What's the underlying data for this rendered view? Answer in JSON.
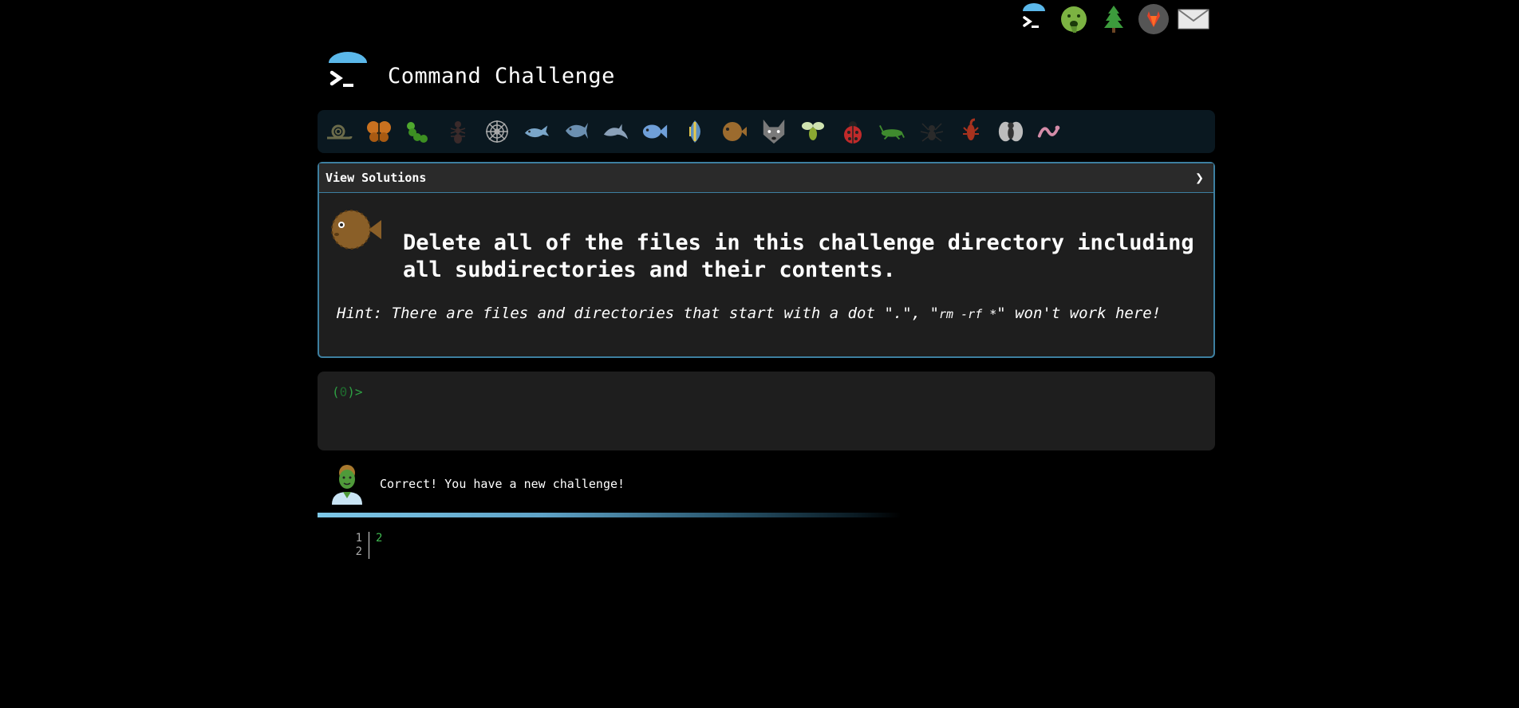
{
  "topnav": {
    "items": [
      {
        "name": "terminal-logo-icon"
      },
      {
        "name": "tux-face-icon"
      },
      {
        "name": "tree-icon"
      },
      {
        "name": "gitlab-icon"
      },
      {
        "name": "mail-icon"
      }
    ]
  },
  "header": {
    "title": "Command Challenge"
  },
  "levels": [
    "snail",
    "butterfly",
    "caterpillar",
    "ant",
    "spider-web",
    "whale",
    "shark",
    "dolphin",
    "fish",
    "tropical-fish",
    "blowfish",
    "wolf",
    "bee",
    "ladybug",
    "cricket",
    "spider",
    "scorpion",
    "fly",
    "worm"
  ],
  "challenge": {
    "solutions_label": "View Solutions",
    "chevron": "❯",
    "text": "Delete all of the files in this challenge directory including all subdirectories and their contents.",
    "hint_prefix": "Hint: There are files and directories that start with a dot \".\", \"",
    "hint_code": "rm -rf *",
    "hint_suffix": "\" won't work here!"
  },
  "terminal": {
    "prompt_open": "(",
    "prompt_zero": "0",
    "prompt_close": ")>",
    "input_value": ""
  },
  "feedback": {
    "message": "Correct! You have a new challenge!"
  },
  "output": {
    "line_numbers": [
      "1",
      "2"
    ],
    "lines": [
      "2",
      ""
    ]
  },
  "colors": {
    "accent": "#3d7fa0",
    "prompt_green": "#2ea043",
    "progress": "#7ec8e8"
  }
}
